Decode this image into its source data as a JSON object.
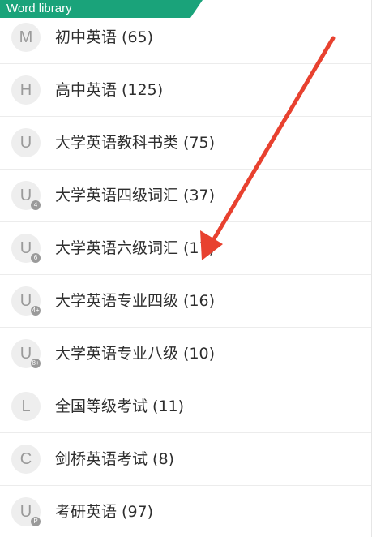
{
  "header": {
    "title": "Word library",
    "accent_color": "#1aa37a"
  },
  "list": [
    {
      "avatar_letter": "M",
      "avatar_sub": "",
      "label": "初中英语 (65)"
    },
    {
      "avatar_letter": "H",
      "avatar_sub": "",
      "label": "高中英语 (125)"
    },
    {
      "avatar_letter": "U",
      "avatar_sub": "",
      "label": "大学英语教科书类 (75)"
    },
    {
      "avatar_letter": "U",
      "avatar_sub": "4",
      "label": "大学英语四级词汇 (37)"
    },
    {
      "avatar_letter": "U",
      "avatar_sub": "6",
      "label": "大学英语六级词汇 (17)"
    },
    {
      "avatar_letter": "U",
      "avatar_sub": "4+",
      "label": "大学英语专业四级 (16)"
    },
    {
      "avatar_letter": "U",
      "avatar_sub": "8+",
      "label": "大学英语专业八级 (10)"
    },
    {
      "avatar_letter": "L",
      "avatar_sub": "",
      "label": "全国等级考试 (11)"
    },
    {
      "avatar_letter": "C",
      "avatar_sub": "",
      "label": "剑桥英语考试 (8)"
    },
    {
      "avatar_letter": "U",
      "avatar_sub": "P",
      "label": "考研英语 (97)"
    }
  ],
  "annotation": {
    "arrow_color": "#e8412f",
    "arrow_icon": "red-arrow-annotation"
  }
}
